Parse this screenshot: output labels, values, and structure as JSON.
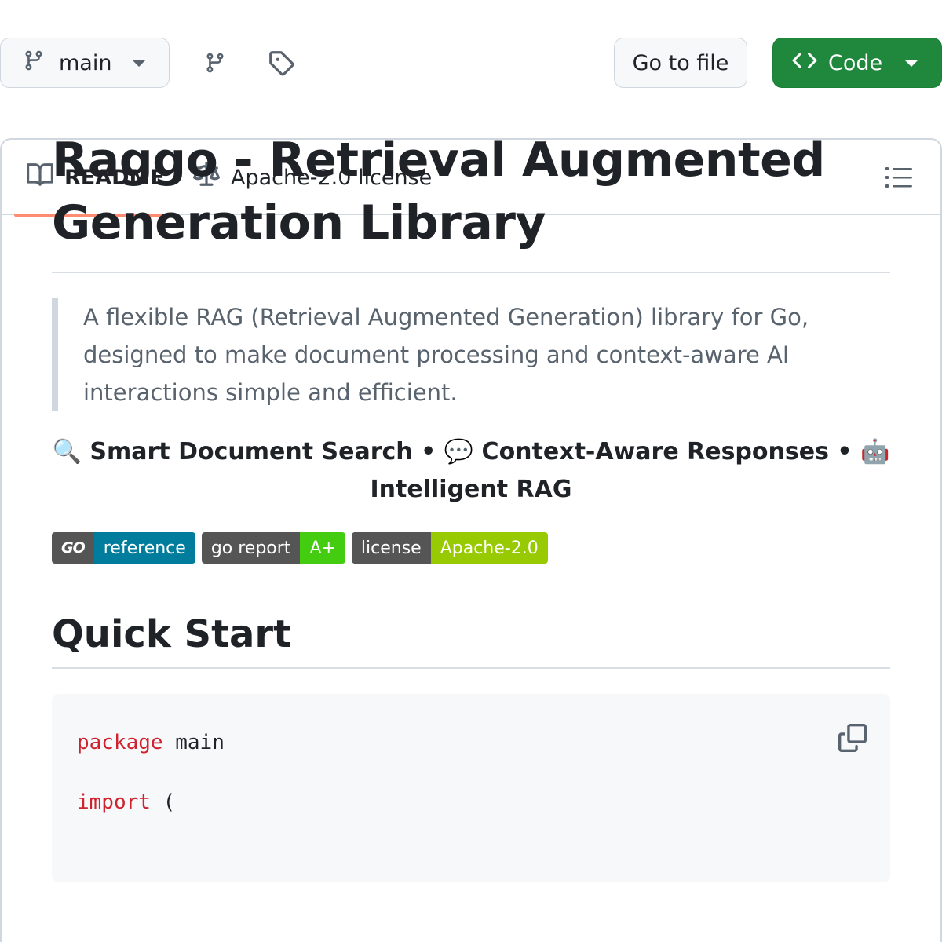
{
  "toolbar": {
    "branch_label": "main",
    "go_to_file_label": "Go to file",
    "code_label": "Code"
  },
  "readme_tabs": {
    "readme_label": "README",
    "license_label": "Apache-2.0 license"
  },
  "article": {
    "title": "Raggo - Retrieval Augmented Generation Library",
    "description": "A flexible RAG (Retrieval Augmented Generation) library for Go, designed to make document processing and context-aware AI interactions simple and efficient.",
    "tagline": {
      "item1_emoji": "🔍",
      "item1": "Smart Document Search",
      "separator": "•",
      "item2_emoji": "💬",
      "item2": "Context-Aware Responses",
      "item3_emoji": "🤖",
      "item3": "Intelligent RAG"
    },
    "badges": [
      {
        "left": "GO",
        "right": "reference",
        "color": "#007d9c"
      },
      {
        "left": "go report",
        "right": "A+",
        "color": "#44cc11"
      },
      {
        "left": "license",
        "right": "Apache-2.0",
        "color": "#97ca00"
      }
    ],
    "quick_start_heading": "Quick Start",
    "code": {
      "line1_keyword": "package",
      "line1_rest": " main",
      "line2_keyword": "import",
      "line2_rest": " ("
    }
  },
  "colors": {
    "code_button": "#1f883d",
    "active_tab_underline": "#fd8c73",
    "keyword": "#cf222e"
  },
  "icons": [
    "git-branch-icon",
    "caret-down-icon",
    "branches-icon",
    "tag-icon",
    "code-brackets-icon",
    "book-icon",
    "law-scale-icon",
    "list-outline-icon",
    "copy-icon"
  ]
}
